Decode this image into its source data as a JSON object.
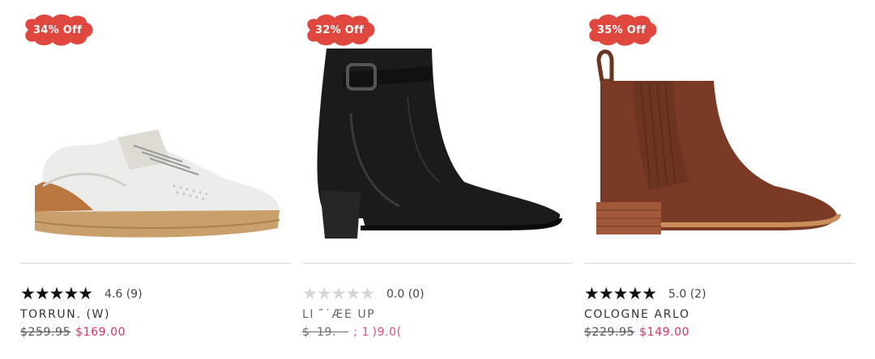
{
  "badge_color": "#e0473f",
  "products": [
    {
      "discount": "34% Off",
      "rating": 4.6,
      "rating_text": "4.6 (9)",
      "name": "TORRUN. (W)",
      "was_price": "$259.95",
      "sale_price": "$169.00",
      "image_icon": "sneaker-image"
    },
    {
      "discount": "32% Off",
      "rating": 0.0,
      "rating_text": "0.0 (0)",
      "name": "LI ˜˙ÆE UP",
      "was_price": "$  19.    ",
      "sale_price": "; 1 )9.0(",
      "image_icon": "black-ankle-boot-image"
    },
    {
      "discount": "35% Off",
      "rating": 5.0,
      "rating_text": "5.0 (2)",
      "name": "COLOGNE ARLO",
      "was_price": "$229.95",
      "sale_price": "$149.00",
      "image_icon": "chelsea-boot-image"
    }
  ]
}
